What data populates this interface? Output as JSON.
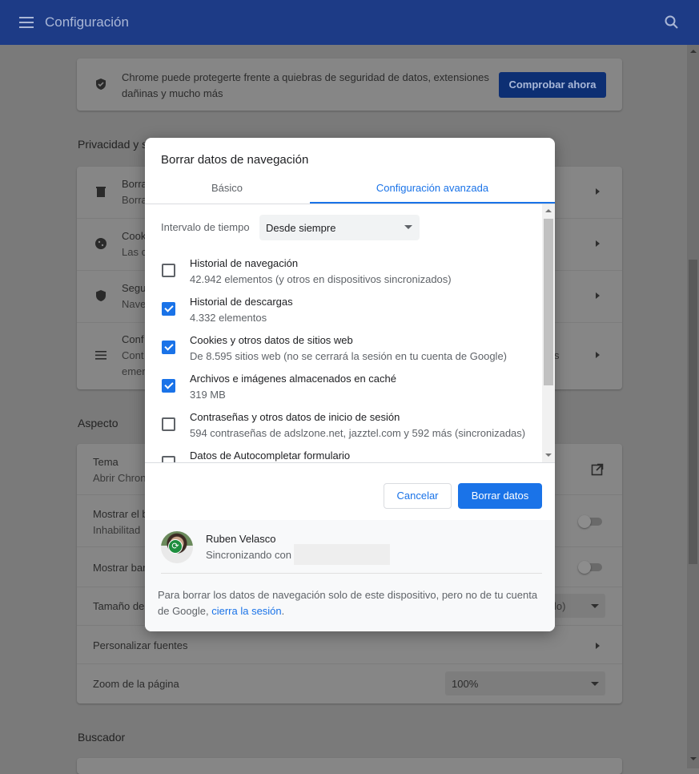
{
  "header": {
    "title": "Configuración",
    "menu_icon": "menu-icon",
    "search_icon": "search-icon"
  },
  "background": {
    "safety": {
      "text_line1": "Chrome puede protegerte frente a quiebras de seguridad de datos, extensiones",
      "text_line2": "dañinas y mucho más",
      "button": "Comprobar ahora"
    },
    "privacy_title": "Privacidad y s",
    "privacy_rows": [
      {
        "title": "Borra",
        "sub": "Borra"
      },
      {
        "title": "Cook",
        "sub": "Las c"
      },
      {
        "title": "Segu",
        "sub": "Nave"
      },
      {
        "title": "Conf",
        "sub": "Cont",
        "sub2": "emer"
      }
    ],
    "appearance_title": "Aspecto",
    "appearance_rows": [
      {
        "title": "Tema",
        "sub": "Abrir Chron"
      },
      {
        "title": "Mostrar el b",
        "sub": "Inhabilitad"
      },
      {
        "title": "Mostrar bar"
      },
      {
        "title": "Tamaño de",
        "value_fragment": "lo)"
      },
      {
        "title": "Personalizar fuentes"
      },
      {
        "title": "Zoom de la página",
        "value": "100%"
      }
    ],
    "search_title": "Buscador",
    "privacy_right_fragment": "s"
  },
  "dialog": {
    "title": "Borrar datos de navegación",
    "tabs": [
      {
        "label": "Básico",
        "active": false
      },
      {
        "label": "Configuración avanzada",
        "active": true
      }
    ],
    "time_range": {
      "label": "Intervalo de tiempo",
      "value": "Desde siempre"
    },
    "items": [
      {
        "title": "Historial de navegación",
        "detail": "42.942 elementos (y otros en dispositivos sincronizados)",
        "checked": false
      },
      {
        "title": "Historial de descargas",
        "detail": "4.332 elementos",
        "checked": true
      },
      {
        "title": "Cookies y otros datos de sitios web",
        "detail": "De 8.595 sitios web (no se cerrará la sesión en tu cuenta de Google)",
        "checked": true
      },
      {
        "title": "Archivos e imágenes almacenados en caché",
        "detail": "319 MB",
        "checked": true
      },
      {
        "title": "Contraseñas y otros datos de inicio de sesión",
        "detail": "594 contraseñas de adslzone.net, jazztel.com y 592 más (sincronizadas)",
        "checked": false
      },
      {
        "title": "Datos de Autocompletar formulario",
        "detail": "",
        "checked": false
      }
    ],
    "cancel": "Cancelar",
    "clear": "Borrar datos",
    "user": {
      "name": "Ruben Velasco",
      "sync": "Sincronizando con"
    },
    "note_text": "Para borrar los datos de navegación solo de este dispositivo, pero no de tu cuenta de Google, ",
    "note_link": "cierra la sesión",
    "note_end": "."
  },
  "colors": {
    "accent": "#1a73e8",
    "header": "#1d3b86",
    "sync_badge": "#1e8e3e"
  }
}
